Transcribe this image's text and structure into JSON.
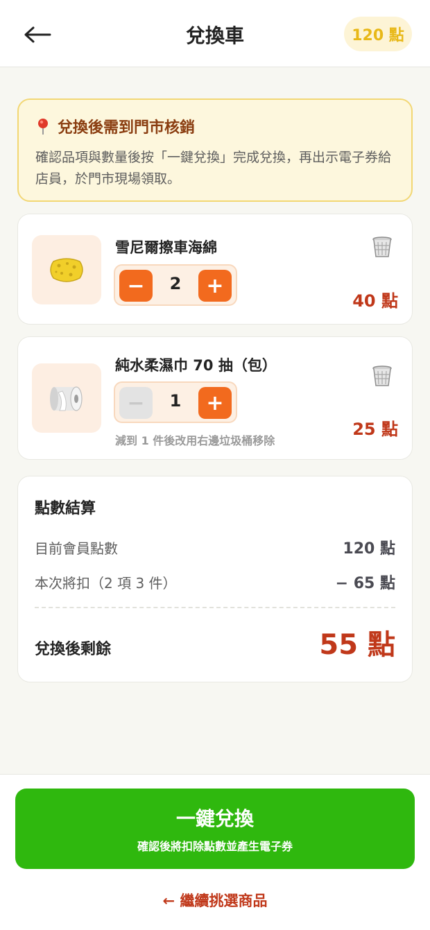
{
  "header": {
    "back_icon": "arrow-left-icon",
    "title": "兌換車",
    "points_badge": "120 點"
  },
  "notice": {
    "icon": "map-pin-icon",
    "title": "兌換後需到門市核銷",
    "body": "確認品項與數量後按「一鍵兌換」完成兌換，再出示電子券給店員，於門市現場領取。"
  },
  "cart": {
    "items": [
      {
        "name": "雪尼爾擦車海綿",
        "icon": "sponge-icon",
        "quantity": "2",
        "minus": "−",
        "plus": "+",
        "points": "40 點",
        "trash_icon": "trash-icon"
      },
      {
        "name": "純水柔濕巾 70 抽（包）",
        "icon": "tissue-roll-icon",
        "quantity": "1",
        "minus": "−",
        "plus": "+",
        "points": "25 點",
        "trash_icon": "trash-icon",
        "hint": "減到 1 件後改用右邊垃圾桶移除"
      }
    ]
  },
  "summary": {
    "title": "點數結算",
    "balance_label": "目前會員點數",
    "balance_value": "120 點",
    "deduct_label": "本次將扣（2 項 3 件）",
    "deduct_value": "− 65 點",
    "remain_label": "兌換後剩餘",
    "remain_value": "55 點"
  },
  "footer": {
    "redeem_label": "一鍵兌換",
    "redeem_sub": "確認後將扣除點數並產生電子券",
    "continue_label": "← 繼續挑選商品"
  },
  "colors": {
    "accent_green": "#2fb80e",
    "accent_orange": "#f26a1e",
    "points_red": "#c0381a",
    "badge_yellow": "#e8b818"
  }
}
